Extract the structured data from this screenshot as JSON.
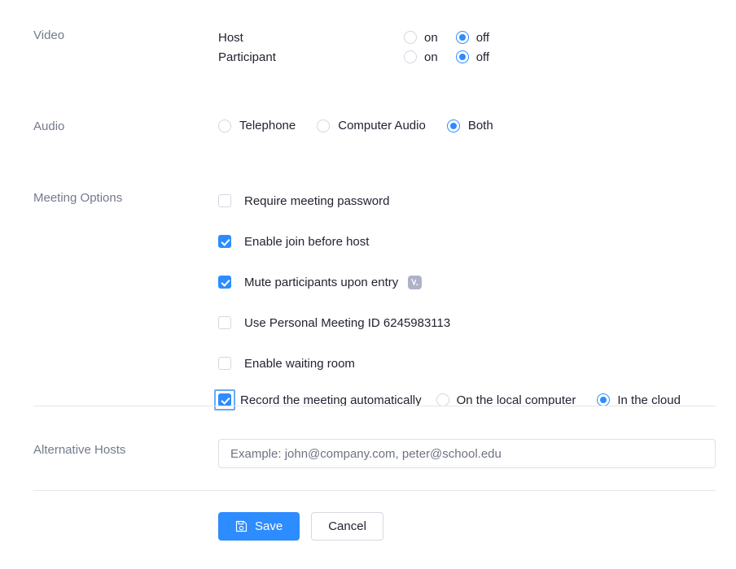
{
  "sections": {
    "video": {
      "label": "Video",
      "rows": [
        {
          "name": "Host",
          "options": [
            {
              "label": "on",
              "selected": false
            },
            {
              "label": "off",
              "selected": true
            }
          ]
        },
        {
          "name": "Participant",
          "options": [
            {
              "label": "on",
              "selected": false
            },
            {
              "label": "off",
              "selected": true
            }
          ]
        }
      ]
    },
    "audio": {
      "label": "Audio",
      "options": [
        {
          "label": "Telephone",
          "selected": false
        },
        {
          "label": "Computer Audio",
          "selected": false
        },
        {
          "label": "Both",
          "selected": true
        }
      ]
    },
    "meeting_options": {
      "label": "Meeting Options",
      "items": [
        {
          "label": "Require meeting password",
          "checked": false
        },
        {
          "label": "Enable join before host",
          "checked": true
        },
        {
          "label": "Mute participants upon entry",
          "checked": true,
          "badge_icon": "broken-image-icon"
        },
        {
          "label": "Use Personal Meeting ID 6245983113",
          "checked": false
        },
        {
          "label": "Enable waiting room",
          "checked": false
        },
        {
          "label": "Record the meeting automatically",
          "checked": true,
          "focused": true,
          "sub_options": [
            {
              "label": "On the local computer",
              "selected": false
            },
            {
              "label": "In the cloud",
              "selected": true
            }
          ]
        }
      ]
    },
    "alternative_hosts": {
      "label": "Alternative Hosts",
      "value": "",
      "placeholder": "Example: john@company.com, peter@school.edu"
    }
  },
  "footer": {
    "save_label": "Save",
    "save_icon": "save-floppy-icon",
    "cancel_label": "Cancel"
  },
  "colors": {
    "accent_blue": "#2d8cff",
    "focus_ring": "#6aa9f4",
    "label_grey": "#747a8c",
    "text_dark": "#232333",
    "divider": "#e6e6e6",
    "badge_grey": "#aeb2c6"
  }
}
